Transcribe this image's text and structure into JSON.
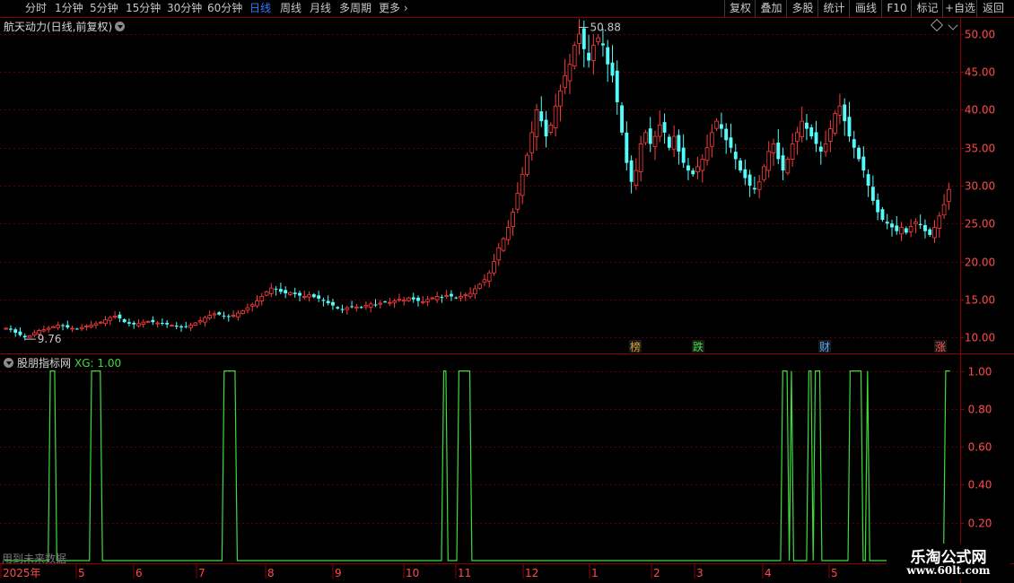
{
  "toolbar": {
    "periods": [
      "分时",
      "1分钟",
      "5分钟",
      "15分钟",
      "30分钟",
      "60分钟",
      "日线",
      "周线",
      "月线",
      "多周期",
      "更多"
    ],
    "active_period": "日线",
    "right_buttons": [
      "复权",
      "叠加",
      "多股",
      "统计",
      "画线",
      "F10",
      "标记",
      "+自选",
      "返回"
    ]
  },
  "main_title": "航天动力(日线,前复权)",
  "indicator": {
    "name": "股朋指标网",
    "value_label": "XG: 1.00"
  },
  "price_axis_labels": [
    "50.00",
    "45.00",
    "40.00",
    "35.00",
    "30.00",
    "25.00",
    "20.00",
    "15.00",
    "10.00"
  ],
  "ind_axis_labels": [
    "1.00",
    "0.80",
    "0.60",
    "0.40",
    "0.20"
  ],
  "high_label": "50.88",
  "low_label": "9.76",
  "event_markers": [
    {
      "text": "榜",
      "color": "#e0a030"
    },
    {
      "text": "跌",
      "color": "#3ddc3d"
    },
    {
      "text": "财",
      "color": "#4aa8ff"
    },
    {
      "text": "涨",
      "color": "#ff5050"
    }
  ],
  "date_labels": [
    "2025年",
    "5",
    "6",
    "7",
    "8",
    "9",
    "10",
    "11",
    "12",
    "1",
    "2",
    "3",
    "4",
    "5"
  ],
  "notice": "用到未来数据",
  "watermark": {
    "line1": "乐淘公式网",
    "line2": "www.60lt.com"
  },
  "colors": {
    "up": "#ff3c3c",
    "down": "#54fcfc",
    "grid": "#5a0000",
    "axis": "#8b0000",
    "signal": "#3ddc3d"
  },
  "chart_data": [
    {
      "type": "candlestick",
      "title": "航天动力(日线,前复权)",
      "ylim": [
        8,
        52
      ],
      "x_labels": [
        "2025年",
        "5",
        "6",
        "7",
        "8",
        "9",
        "10",
        "11",
        "12",
        "1",
        "2",
        "3",
        "4",
        "5"
      ],
      "close_series": [
        11.2,
        11.0,
        10.6,
        10.3,
        10.0,
        10.2,
        10.6,
        10.9,
        11.0,
        11.2,
        11.4,
        11.6,
        11.5,
        11.3,
        11.2,
        11.1,
        11.3,
        11.5,
        11.6,
        11.8,
        12.0,
        12.3,
        12.6,
        12.8,
        12.5,
        12.0,
        11.8,
        11.7,
        11.8,
        12.0,
        12.1,
        12.0,
        11.9,
        11.8,
        11.7,
        11.6,
        11.4,
        11.3,
        11.4,
        11.6,
        11.9,
        12.2,
        12.6,
        12.9,
        13.1,
        13.0,
        12.8,
        12.7,
        12.9,
        13.2,
        13.5,
        13.9,
        14.3,
        14.8,
        15.4,
        16.0,
        16.5,
        16.3,
        16.0,
        15.8,
        15.9,
        15.7,
        15.5,
        15.4,
        15.6,
        15.3,
        15.1,
        14.8,
        14.5,
        14.2,
        13.8,
        13.6,
        13.9,
        14.1,
        14.0,
        13.9,
        14.2,
        14.4,
        14.3,
        14.5,
        14.7,
        14.6,
        14.8,
        15.0,
        14.9,
        15.2,
        15.0,
        14.8,
        14.7,
        15.0,
        15.2,
        15.4,
        15.3,
        15.5,
        15.4,
        15.2,
        15.4,
        15.6,
        15.8,
        16.4,
        17.0,
        17.6,
        18.5,
        20.0,
        21.8,
        23.0,
        24.5,
        26.5,
        29.0,
        31.5,
        34.0,
        37.0,
        40.0,
        38.5,
        36.5,
        38.0,
        40.5,
        42.5,
        44.5,
        46.0,
        48.5,
        50.0,
        48.0,
        46.5,
        48.5,
        49.5,
        48.5,
        46.0,
        44.5,
        41.0,
        37.0,
        33.0,
        30.5,
        32.0,
        35.5,
        37.0,
        35.5,
        36.5,
        38.0,
        37.0,
        35.0,
        36.5,
        34.5,
        33.0,
        32.0,
        31.5,
        32.5,
        33.5,
        35.0,
        37.0,
        38.5,
        37.5,
        36.0,
        35.0,
        33.5,
        32.0,
        31.0,
        30.0,
        29.5,
        30.5,
        32.5,
        34.5,
        35.5,
        33.5,
        32.0,
        33.5,
        35.5,
        37.0,
        38.5,
        37.5,
        36.5,
        35.5,
        34.5,
        35.5,
        37.5,
        39.5,
        40.5,
        38.5,
        36.5,
        35.0,
        33.5,
        32.0,
        30.0,
        28.0,
        26.5,
        25.5,
        25.0,
        24.5,
        24.0,
        24.5,
        23.8,
        24.6,
        25.2,
        24.8,
        24.0,
        23.5,
        24.5,
        26.0,
        27.5,
        29.5
      ],
      "extremes": {
        "high": 50.88,
        "low": 9.76
      }
    },
    {
      "type": "line",
      "title": "股朋指标网",
      "series": [
        {
          "name": "XG",
          "values": [
            0,
            0,
            0,
            0,
            0,
            0,
            0,
            0,
            0,
            0,
            0,
            0,
            0,
            0,
            0,
            0,
            0,
            0,
            0,
            0,
            0,
            1,
            1,
            1,
            0,
            0,
            0,
            0,
            0,
            0,
            0,
            0,
            0,
            0,
            0,
            0,
            0,
            0,
            0,
            0,
            1,
            1,
            1,
            1,
            1,
            0,
            0,
            0,
            0,
            0,
            0,
            0,
            0,
            0,
            0,
            0,
            0,
            0,
            0,
            0,
            0,
            0,
            0,
            0,
            0,
            0,
            0,
            0,
            0,
            0,
            0,
            0,
            0,
            0,
            0,
            0,
            0,
            0,
            0,
            0,
            0,
            0,
            0,
            0,
            0,
            0,
            0,
            0,
            0,
            0,
            0,
            0,
            0,
            0,
            0,
            0,
            0,
            0,
            0,
            0,
            0,
            1,
            1,
            1,
            1,
            1,
            1,
            0,
            0,
            0,
            0,
            0,
            0,
            0,
            0,
            0,
            0,
            0,
            0,
            0,
            0,
            0,
            0,
            0,
            0,
            0,
            0,
            0,
            0,
            0,
            0,
            0,
            0,
            0,
            0,
            0,
            0,
            0,
            0,
            0,
            0,
            0,
            0,
            0,
            0,
            0,
            0,
            0,
            0,
            0,
            0,
            0,
            0,
            0,
            0,
            0,
            0,
            0,
            0,
            0,
            0,
            0,
            0,
            0,
            0,
            0,
            0,
            0,
            0,
            0,
            0,
            0,
            0,
            0,
            0,
            0,
            0,
            0,
            0,
            0,
            0,
            0,
            0,
            0,
            0,
            0,
            0,
            0,
            0,
            0,
            0,
            0,
            0,
            0,
            0,
            0,
            0,
            0,
            0,
            0,
            0,
            0,
            1,
            1,
            0,
            0,
            0,
            0,
            0,
            1,
            1,
            1,
            1,
            1,
            1,
            0,
            0,
            0,
            0,
            0,
            0,
            0,
            0,
            0,
            0,
            0,
            0,
            0,
            0,
            0,
            0,
            0,
            0,
            0,
            0,
            0,
            0,
            0,
            0,
            0,
            0,
            0,
            0,
            0,
            0,
            0,
            0,
            0,
            0,
            0,
            0,
            0,
            0,
            0,
            0,
            0,
            0,
            0,
            0,
            0,
            0,
            0,
            0,
            0,
            0,
            0,
            0,
            0,
            0,
            0,
            0,
            0,
            0,
            0,
            0,
            0,
            0,
            0,
            0,
            0,
            0,
            0,
            0,
            0,
            0,
            0,
            0,
            0,
            0,
            0,
            0,
            0,
            0,
            0,
            0,
            0,
            0,
            0,
            0,
            0,
            0,
            0,
            0,
            0,
            0,
            0,
            0,
            0,
            0,
            0,
            0,
            0,
            0,
            0,
            0,
            0,
            0,
            0,
            0,
            0,
            0,
            0,
            0,
            0,
            0,
            0,
            0,
            0,
            0,
            0,
            0,
            0,
            0,
            0,
            0,
            0,
            0,
            0,
            0,
            0,
            0,
            0,
            0,
            0,
            0,
            0,
            0,
            0,
            0,
            0,
            0,
            0,
            0,
            0,
            0,
            0,
            0,
            0,
            1,
            1,
            1,
            0,
            1,
            0,
            0,
            0,
            0,
            0,
            0,
            0,
            1,
            1,
            0,
            1,
            1,
            1,
            0,
            0,
            0,
            0,
            0,
            0,
            0,
            0,
            0,
            0,
            0,
            0,
            0,
            1,
            1,
            1,
            1,
            1,
            1,
            0,
            0,
            1,
            0,
            0,
            0,
            0,
            0,
            0,
            0,
            0,
            0,
            0,
            0,
            0,
            0,
            0,
            0,
            0,
            0,
            0,
            0,
            0,
            0,
            0,
            0,
            0,
            0,
            0,
            0,
            0,
            0,
            0,
            0,
            0,
            0,
            0,
            0,
            1,
            1,
            1
          ]
        }
      ],
      "ylim": [
        0,
        1.05
      ],
      "yticks": [
        1.0,
        0.8,
        0.6,
        0.4,
        0.2
      ]
    }
  ]
}
